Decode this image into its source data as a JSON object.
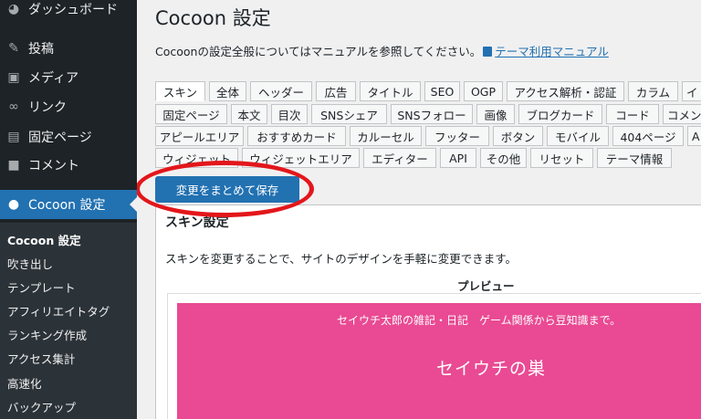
{
  "sidebar": {
    "items": [
      {
        "label": "ダッシュボード",
        "icon": "dashboard-icon"
      },
      {
        "label": "投稿",
        "icon": "pin-icon"
      },
      {
        "label": "メディア",
        "icon": "media-icon"
      },
      {
        "label": "リンク",
        "icon": "link-icon"
      },
      {
        "label": "固定ページ",
        "icon": "page-icon"
      },
      {
        "label": "コメント",
        "icon": "comment-icon"
      },
      {
        "label": "Cocoon 設定",
        "icon": "cocoon-icon"
      }
    ],
    "submenu": [
      "Cocoon 設定",
      "吹き出し",
      "テンプレート",
      "アフィリエイトタグ",
      "ランキング作成",
      "アクセス集計",
      "高速化",
      "バックアップ"
    ],
    "active_color": "#2271b1"
  },
  "main": {
    "title": "Cocoon 設定",
    "intro_text": "Cocoonの設定全般についてはマニュアルを参照してください。",
    "manual_link": "テーマ利用マニュアル",
    "tabs_row1": [
      "スキン",
      "全体",
      "ヘッダー",
      "広告",
      "タイトル",
      "SEO",
      "OGP",
      "アクセス解析・認証",
      "カラム",
      "イ"
    ],
    "tabs_row2": [
      "固定ページ",
      "本文",
      "目次",
      "SNSシェア",
      "SNSフォロー",
      "画像",
      "ブログカード",
      "コード",
      "コメン"
    ],
    "tabs_row3": [
      "アピールエリア",
      "おすすめカード",
      "カルーセル",
      "フッター",
      "ボタン",
      "モバイル",
      "404ページ",
      "A"
    ],
    "tabs_row4": [
      "ウィジェット",
      "ウィジェットエリア",
      "エディター",
      "API",
      "その他",
      "リセット",
      "テーマ情報"
    ],
    "save_button": "変更をまとめて保存",
    "skin_heading": "スキン設定",
    "skin_description": "スキンを変更することで、サイトのデザインを手軽に変更できます。",
    "preview_label": "プレビュー",
    "preview_tagline": "セイウチ太郎の雑記・日記　ゲーム関係から豆知識まで。",
    "preview_site_name": "セイウチの巣",
    "preview_color": "#e94a93",
    "highlight_color": "#e3161b"
  }
}
